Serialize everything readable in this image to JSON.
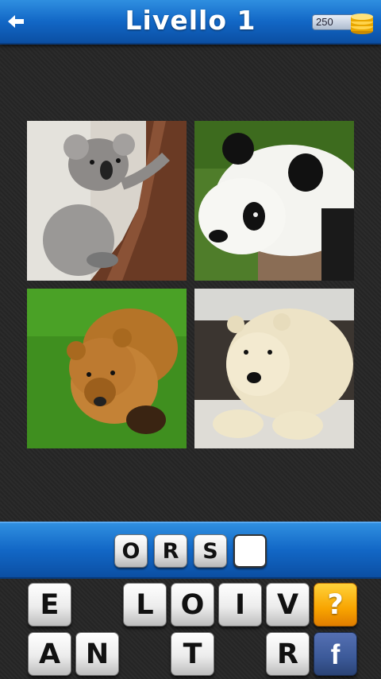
{
  "header": {
    "title": "Livello 1",
    "coins": "250",
    "back_icon": "back-arrow-icon",
    "coin_icon": "coin-stack-icon"
  },
  "photos": [
    {
      "subject": "koala"
    },
    {
      "subject": "panda"
    },
    {
      "subject": "brown-bear"
    },
    {
      "subject": "polar-bear"
    }
  ],
  "answer": {
    "letters": [
      "O",
      "R",
      "S",
      ""
    ]
  },
  "keyboard": {
    "row1": [
      "E",
      "",
      "",
      "L",
      "O",
      "I",
      "V"
    ],
    "row2": [
      "A",
      "N",
      "",
      "T",
      "",
      "R"
    ],
    "hint_label": "?",
    "share_label": "f"
  },
  "colors": {
    "bar_blue": "#1267c6",
    "hint_orange": "#f8a400",
    "facebook_blue": "#3b5998"
  }
}
